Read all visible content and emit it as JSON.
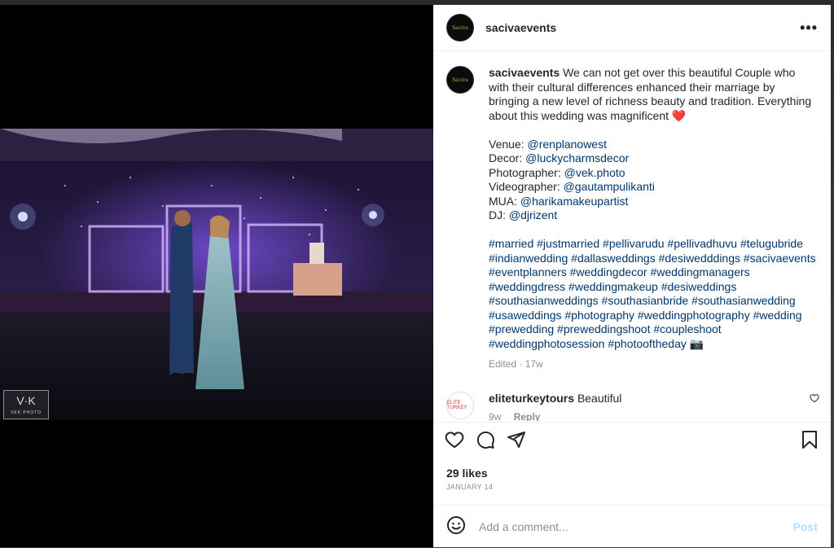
{
  "post": {
    "author": "sacivaevents",
    "avatar_text": "Saciva",
    "more_icon": "more-dots-icon",
    "watermark": "V·K",
    "watermark_sub": "VEK PHOTO"
  },
  "caption": {
    "author": "sacivaevents",
    "text": "We can not get over this beautiful Couple who with their cultural differences enhanced their marriage by bringing a new level of richness beauty and tradition. Everything about this wedding was magnificent",
    "emoji": "❤️",
    "credits": [
      {
        "role": "Venue:",
        "handle": "@renplanowest"
      },
      {
        "role": "Decor:",
        "handle": "@luckycharmsdecor"
      },
      {
        "role": "Photographer:",
        "handle": "@vek.photo"
      },
      {
        "role": "Videographer:",
        "handle": "@gautampulikanti"
      },
      {
        "role": "MUA:",
        "handle": "@harikamakeupartist"
      },
      {
        "role": "DJ:",
        "handle": "@djrizent"
      }
    ],
    "hashtags": "#married #justmarried #pellivarudu #pellivadhuvu #telugubride #indianwedding #dallasweddings #desiwedddings #sacivaevents #eventplanners #weddingdecor #weddingmanagers #weddingdress #weddingmakeup #desiweddings #southasianweddings #southasianbride #southasianwedding #usaweddings #photography #weddingphotography #wedding #prewedding #preweddingshoot #coupleshoot #weddingphotosession #photooftheday 📷",
    "meta": "Edited · 17w"
  },
  "comment": {
    "author": "eliteturkeytours",
    "avatar_text": "ELITE TURKEY",
    "text": "Beautiful",
    "age": "9w",
    "reply": "Reply"
  },
  "actions": {
    "like_icon": "heart-icon",
    "comment_icon": "comment-bubble-icon",
    "share_icon": "send-icon",
    "save_icon": "bookmark-icon"
  },
  "likes": "29 likes",
  "date": "JANUARY 14",
  "add_comment": {
    "placeholder": "Add a comment...",
    "post_label": "Post",
    "emoji_icon": "smiley-icon"
  },
  "colors": {
    "link": "#00376b",
    "muted": "#8e8e8e",
    "post_disabled": "#b2dffc",
    "heart": "#ed4956"
  }
}
